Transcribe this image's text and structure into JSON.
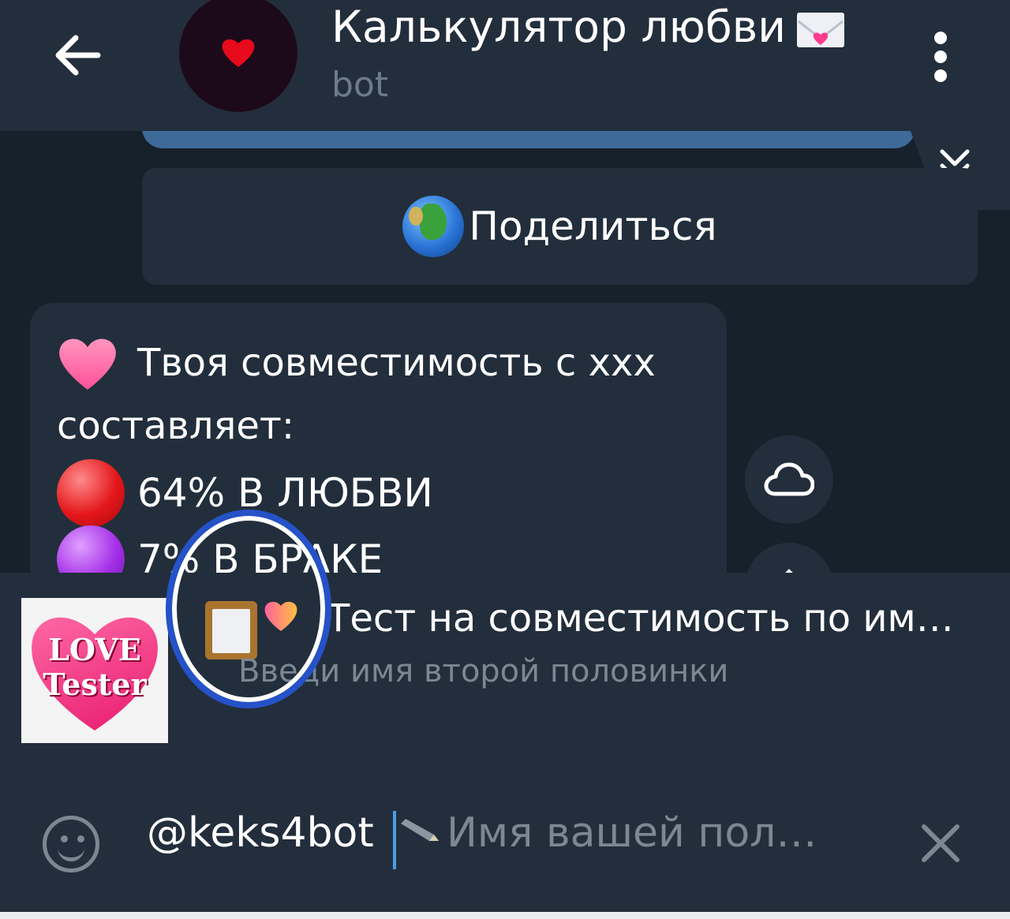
{
  "header": {
    "title": "Калькулятор любви",
    "subtitle": "bot",
    "icons": [
      "arrow-left-icon",
      "heart-avatar",
      "love-letter-icon",
      "more-vertical-icon"
    ]
  },
  "chat": {
    "share_button_label": "Поделиться",
    "message": {
      "line1": "Твоя совместимость с xxx",
      "line2": "составляет:",
      "line3": "64% В ЛЮБВИ",
      "line4": "7% В БРАКЕ"
    },
    "side_icons": [
      "cloud-icon",
      "chevron-up-icon"
    ],
    "scroll_icon": "double-chevron-down-icon"
  },
  "inline_result": {
    "thumb_line1": "LOVE",
    "thumb_line2": "Tester",
    "title": "Тест на совместимость по име…",
    "description": "Введи имя второй половинки"
  },
  "input": {
    "value": "@keks4bot",
    "placeholder": "Имя вашей пол…"
  },
  "colors": {
    "background": "#17212b",
    "header": "#232e3c",
    "accent": "#4c9ce2",
    "annotation": "#2552c8"
  }
}
